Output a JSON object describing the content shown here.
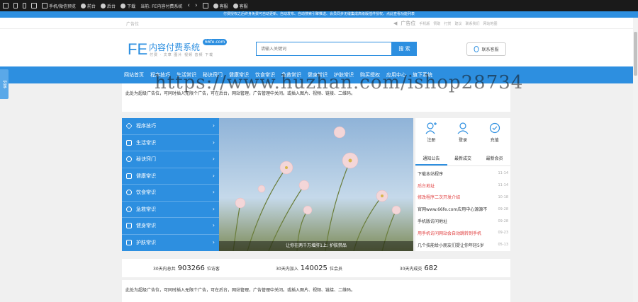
{
  "topbar": {
    "wechat_preview": "手机/微信预览",
    "frontend": "前台",
    "backend": "后台",
    "download": "下载",
    "current": "当前:",
    "current_site": "FE内容付费系统",
    "service1": "客服",
    "service2": "客服"
  },
  "notice": "付费授权之后终身免费可自动更新、自动发布、自动搜索引擎推送、会员同步无缝集成高级版插件授权、点此查看功能列表",
  "adbar": {
    "left": "广告位",
    "right_title": "广告位",
    "links": [
      "手机版",
      "赞助",
      "打赏",
      "建议",
      "联系我们",
      "网站地图"
    ]
  },
  "header": {
    "logo_mark": "FE",
    "logo_title": "内容付费系统",
    "logo_badge": "66fe.com",
    "logo_sub": "付费 · 文章 图片 视频 音频 下载",
    "search_placeholder": "请输入关键词",
    "search_button": "搜 索",
    "service_button": "联系客服"
  },
  "nav": [
    "网站首页",
    "程序技巧",
    "生活常识",
    "秘诀窍门",
    "健康常识",
    "饮食常识",
    "急救常识",
    "健身常识",
    "护肤常识",
    "购买授权",
    "应用中心",
    "旗下系统"
  ],
  "share": "分享",
  "ad_text": "此处为超级广告位，可同时插入无限个广告，可在后台，网站管理，广告管理中关闭。或插入图片、视频、链接、二维码。",
  "watermark": "https://www.huzhan.com/ishop28734",
  "categories": [
    {
      "label": "程序技巧",
      "icon": "diamond-icon"
    },
    {
      "label": "生活常识",
      "icon": "grid-icon"
    },
    {
      "label": "秘诀窍门",
      "icon": "check-circle-icon"
    },
    {
      "label": "健康常识",
      "icon": "image-icon"
    },
    {
      "label": "饮食常识",
      "icon": "info-circle-icon"
    },
    {
      "label": "急救常识",
      "icon": "chat-icon"
    },
    {
      "label": "健身常识",
      "icon": "folder-icon"
    },
    {
      "label": "护肤常识",
      "icon": "columns-icon"
    }
  ],
  "banner_caption": "让你在两千万增肝1上: 护肤禁品",
  "quick_links": [
    {
      "label": "注册",
      "icon": "user-plus-icon"
    },
    {
      "label": "登录",
      "icon": "user-icon"
    },
    {
      "label": "充值",
      "icon": "badge-check-icon"
    }
  ],
  "tabs": [
    "通知公告",
    "最新成交",
    "最新会员"
  ],
  "news": [
    {
      "title": "下载本站程序",
      "date": "11-14",
      "color": "#333333"
    },
    {
      "title": "后台地址",
      "date": "11-14",
      "color": "#e03c3c"
    },
    {
      "title": "修改程序二次开发介绍",
      "date": "10-18",
      "color": "#e03c3c"
    },
    {
      "title": "官网www.66fe.com应用中心源源不",
      "date": "09-28",
      "color": "#333333"
    },
    {
      "title": "手机版访问地址",
      "date": "09-28",
      "color": "#333333"
    },
    {
      "title": "用手机访问网站会自动跳转到手机",
      "date": "09-23",
      "color": "#e03c3c"
    },
    {
      "title": "几个技能给小朋友们提让你年轻5岁",
      "date": "05-13",
      "color": "#333333"
    }
  ],
  "stats": [
    {
      "label": "30天内总共",
      "value": "903266",
      "unit": "位访客"
    },
    {
      "label": "30天内加入",
      "value": "140025",
      "unit": "位会员"
    },
    {
      "label": "30天内成交",
      "value": "682",
      "unit": ""
    }
  ],
  "colors": {
    "primary": "#2d8fe0",
    "dark": "#1a1a1a",
    "red": "#e03c3c"
  }
}
